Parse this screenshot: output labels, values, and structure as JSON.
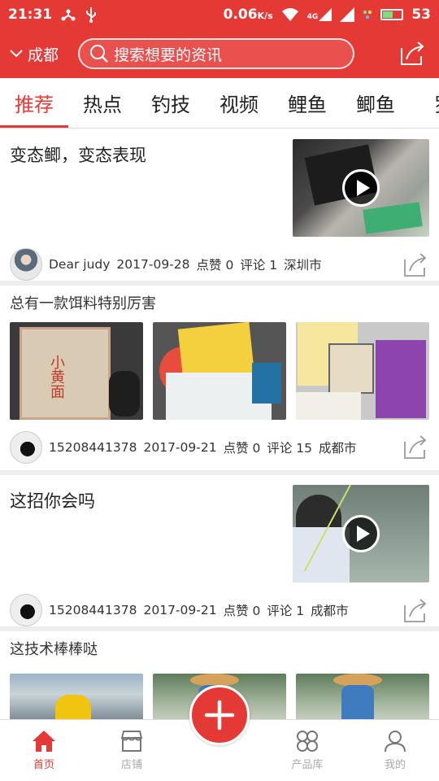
{
  "status_bar": {
    "time": "21:31",
    "speed": "0.06",
    "speed_unit": "K/s",
    "network": "4G",
    "battery": "53",
    "battery_level": 0.53
  },
  "header": {
    "city": "成都",
    "search_placeholder": "搜索想要的资讯"
  },
  "tabs": [
    {
      "label": "推荐",
      "active": true
    },
    {
      "label": "热点"
    },
    {
      "label": "钓技"
    },
    {
      "label": "视频"
    },
    {
      "label": "鲤鱼"
    },
    {
      "label": "鲫鱼"
    },
    {
      "label": "罗"
    }
  ],
  "feed": [
    {
      "title": "变态鲫，变态表现",
      "author": "Dear judy",
      "date": "2017-09-28",
      "likes": "点赞 0",
      "comments": "评论 1",
      "location": "深圳市"
    },
    {
      "title": "总有一款饵料特别厉害",
      "author": "15208441378",
      "date": "2017-09-21",
      "likes": "点赞 0",
      "comments": "评论 15",
      "location": "成都市"
    },
    {
      "title": "这招你会吗",
      "author": "15208441378",
      "date": "2017-09-21",
      "likes": "点赞 0",
      "comments": "评论 1",
      "location": "成都市"
    },
    {
      "title": "这技术棒棒哒"
    }
  ],
  "bottom_nav": [
    {
      "label": "首页",
      "icon": "home-icon",
      "active": true
    },
    {
      "label": "店铺",
      "icon": "shop-icon"
    },
    {
      "label": "产品库",
      "icon": "grid-icon"
    },
    {
      "label": "我的",
      "icon": "user-icon"
    }
  ],
  "colors": {
    "accent": "#e53935",
    "inactive": "#aaaaaa"
  }
}
